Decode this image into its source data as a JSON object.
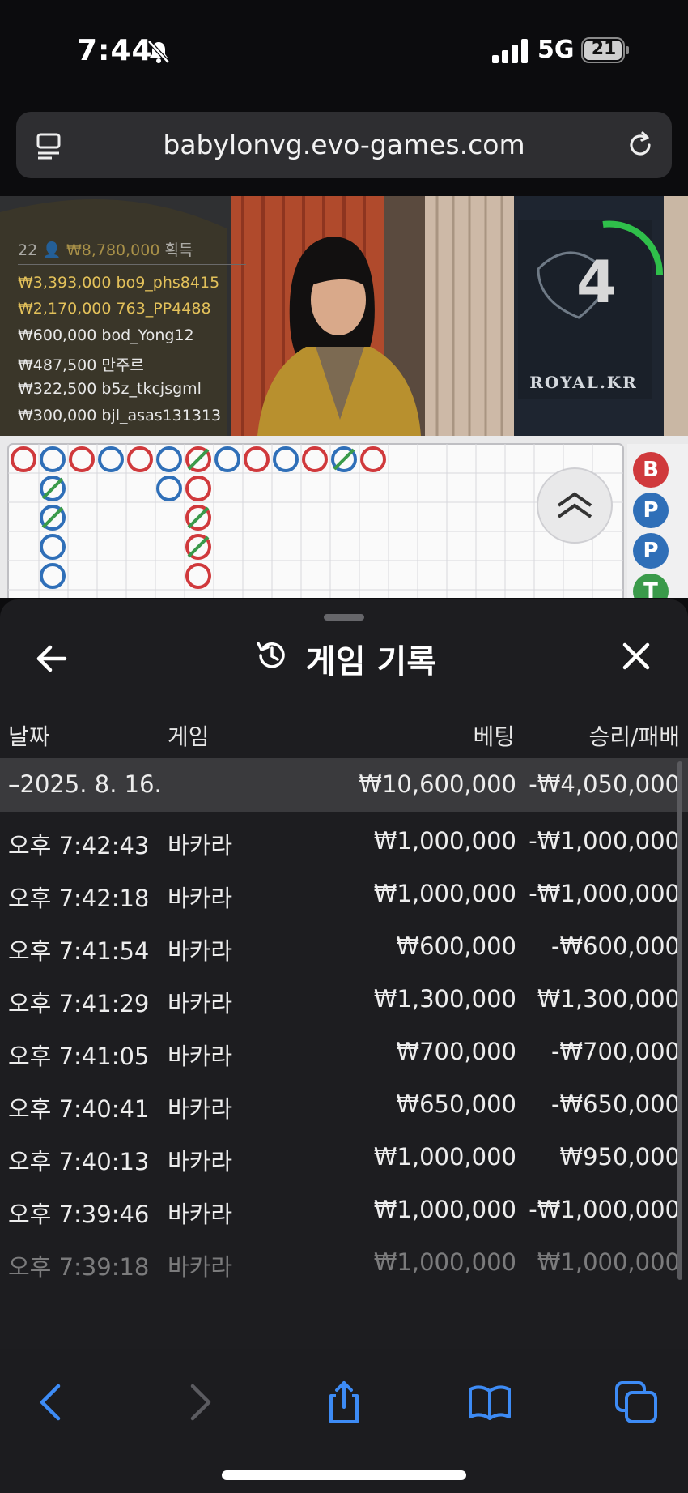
{
  "status_bar": {
    "time": "7:44",
    "network": "5G",
    "battery": "21"
  },
  "browser": {
    "url": "babylonvg.evo-games.com"
  },
  "video": {
    "leaderboard_header": {
      "players": "22",
      "total": "₩8,780,000",
      "suffix": "획득"
    },
    "leaderboard": [
      {
        "amount": "₩3,393,000",
        "name": "bo9_phs8415",
        "highlight": true
      },
      {
        "amount": "₩2,170,000",
        "name": "763_PP4488",
        "highlight": true
      },
      {
        "amount": "₩600,000",
        "name": "bod_Yong12",
        "highlight": false
      },
      {
        "amount": "₩487,500",
        "name": "만주르",
        "highlight": false
      },
      {
        "amount": "₩322,500",
        "name": "b5z_tkcjsgml",
        "highlight": false
      },
      {
        "amount": "₩300,000",
        "name": "bjl_asas131313",
        "highlight": false
      }
    ],
    "countdown": "4",
    "table_brand": "ROYAL.KR"
  },
  "bead_road": {
    "predictions": [
      {
        "letter": "B",
        "color": "#d0393c"
      },
      {
        "letter": "P",
        "color": "#2f6fb8"
      },
      {
        "letter": "P",
        "color": "#2f6fb8"
      },
      {
        "letter": "T",
        "color": "#3a9a4a"
      }
    ]
  },
  "sheet": {
    "title": "게임 기록",
    "columns": {
      "date": "날짜",
      "game": "게임",
      "bet": "베팅",
      "result": "승리/패배"
    },
    "date_group": {
      "date": "–2025. 8. 16.",
      "bet": "₩10,600,000",
      "result": "-₩4,050,000"
    },
    "rows": [
      {
        "time": "오후 7:42:43",
        "game": "바카라",
        "bet": "₩1,000,000",
        "result": "-₩1,000,000"
      },
      {
        "time": "오후 7:42:18",
        "game": "바카라",
        "bet": "₩1,000,000",
        "result": "-₩1,000,000"
      },
      {
        "time": "오후 7:41:54",
        "game": "바카라",
        "bet": "₩600,000",
        "result": "-₩600,000"
      },
      {
        "time": "오후 7:41:29",
        "game": "바카라",
        "bet": "₩1,300,000",
        "result": "₩1,300,000"
      },
      {
        "time": "오후 7:41:05",
        "game": "바카라",
        "bet": "₩700,000",
        "result": "-₩700,000"
      },
      {
        "time": "오후 7:40:41",
        "game": "바카라",
        "bet": "₩650,000",
        "result": "-₩650,000"
      },
      {
        "time": "오후 7:40:13",
        "game": "바카라",
        "bet": "₩1,000,000",
        "result": "₩950,000"
      },
      {
        "time": "오후 7:39:46",
        "game": "바카라",
        "bet": "₩1,000,000",
        "result": "-₩1,000,000"
      },
      {
        "time": "오후 7:39:18",
        "game": "바카라",
        "bet": "₩1,000,000",
        "result": "₩1,000,000"
      }
    ]
  },
  "colors": {
    "accent_blue": "#3d8bf5",
    "banker": "#d0393c",
    "player": "#2f6fb8",
    "tie": "#3a9a4a",
    "gold": "#e3c15a"
  }
}
